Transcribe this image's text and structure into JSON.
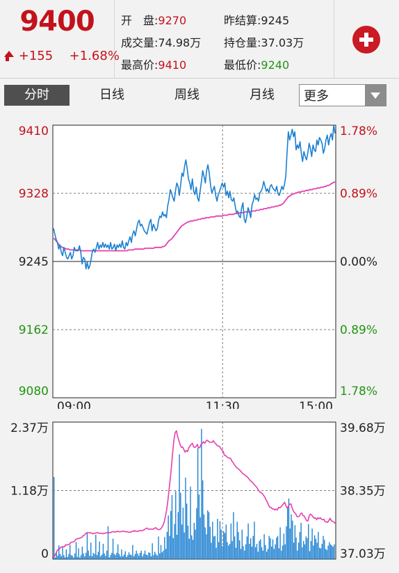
{
  "header": {
    "price": "9400",
    "change": "+155",
    "change_pct": "+1.68%",
    "stats": {
      "open_label": "开　盘:",
      "open_value": "9270",
      "prev_settle_label": "昨结算:",
      "prev_settle_value": "9245",
      "volume_label": "成交量:",
      "volume_value": "74.98万",
      "open_interest_label": "持仓量:",
      "open_interest_value": "37.03万",
      "high_label": "最高价:",
      "high_value": "9410",
      "low_label": "最低价:",
      "low_value": "9240"
    },
    "add_icon": "plus-circle-icon"
  },
  "tabs": [
    {
      "label": "分时",
      "active": true
    },
    {
      "label": "日线",
      "active": false
    },
    {
      "label": "周线",
      "active": false
    },
    {
      "label": "月线",
      "active": false
    }
  ],
  "more_select": {
    "label": "更多",
    "icon": "chevron-down-icon"
  },
  "colors": {
    "up": "#c3121b",
    "down": "#229412",
    "price_line": "#1b7fd1",
    "avg_line": "#e43fb0",
    "volume_bar": "#1b7fd1"
  },
  "chart_data": [
    {
      "type": "line",
      "title": "",
      "x_ticks": [
        "09:00",
        "11:30",
        "15:00"
      ],
      "y_ticks_left": [
        "9410",
        "9328",
        "9245",
        "9162",
        "9080"
      ],
      "y_ticks_right": [
        "1.78%",
        "0.89%",
        "0.00%",
        "0.89%",
        "1.78%"
      ],
      "ylim": [
        9080,
        9410
      ],
      "prev_close": 9245,
      "series": [
        {
          "values": [
            9285,
            9278,
            9272,
            9268,
            9260,
            9265,
            9256,
            9252,
            9262,
            9256,
            9250,
            9248,
            9252,
            9256,
            9248,
            9252,
            9262,
            9258,
            9258,
            9258,
            9264,
            9256,
            9242,
            9250,
            9248,
            9236,
            9244,
            9236,
            9240,
            9248,
            9258,
            9260,
            9256,
            9262,
            9268,
            9260,
            9265,
            9262,
            9268,
            9262,
            9266,
            9262,
            9265,
            9260,
            9268,
            9260,
            9262,
            9266,
            9258,
            9265,
            9262,
            9266,
            9262,
            9270,
            9262,
            9260,
            9268,
            9264,
            9270,
            9275,
            9268,
            9278,
            9282,
            9276,
            9284,
            9292,
            9295,
            9288,
            9290,
            9286,
            9282,
            9280,
            9278,
            9285,
            9292,
            9296,
            9282,
            9290,
            9286,
            9282,
            9285,
            9295,
            9300,
            9298,
            9305,
            9300,
            9302,
            9298,
            9312,
            9320,
            9332,
            9328,
            9322,
            9318,
            9330,
            9340,
            9336,
            9325,
            9338,
            9352,
            9348,
            9360,
            9368,
            9358,
            9345,
            9340,
            9332,
            9345,
            9330,
            9326,
            9335,
            9322,
            9318,
            9330,
            9342,
            9355,
            9348,
            9340,
            9355,
            9362,
            9352,
            9338,
            9328,
            9332,
            9336,
            9325,
            9318,
            9326,
            9330,
            9335,
            9340,
            9335,
            9340,
            9325,
            9330,
            9322,
            9330,
            9320,
            9318,
            9322,
            9312,
            9304,
            9306,
            9300,
            9298,
            9310,
            9316,
            9296,
            9292,
            9300,
            9310,
            9305,
            9298,
            9314,
            9318,
            9326,
            9320,
            9322,
            9318,
            9328,
            9330,
            9334,
            9342,
            9336,
            9330,
            9333,
            9328,
            9336,
            9338,
            9334,
            9332,
            9330,
            9336,
            9327,
            9325,
            9330,
            9336,
            9332,
            9338,
            9348,
            9376,
            9402,
            9392,
            9398,
            9405,
            9396,
            9402,
            9380,
            9386,
            9382,
            9390,
            9376,
            9366,
            9378,
            9372,
            9368,
            9376,
            9388,
            9382,
            9372,
            9386,
            9380,
            9378,
            9392,
            9386,
            9395,
            9392,
            9388,
            9376,
            9382,
            9392,
            9398,
            9386,
            9395,
            9400,
            9392,
            9410,
            9400
          ]
        },
        {
          "values": [
            9273,
            9272,
            9270,
            9268,
            9266,
            9264,
            9263,
            9262,
            9261,
            9261,
            9260,
            9260,
            9260,
            9259,
            9259,
            9259,
            9259,
            9259,
            9259,
            9259,
            9259,
            9259,
            9258,
            9258,
            9258,
            9258,
            9258,
            9258,
            9258,
            9258,
            9258,
            9258,
            9258,
            9258,
            9258,
            9258,
            9258,
            9258,
            9258,
            9258,
            9258,
            9258,
            9258,
            9258,
            9258,
            9258,
            9258,
            9258,
            9258,
            9258,
            9258,
            9258,
            9258,
            9258,
            9258,
            9258,
            9258,
            9258,
            9258,
            9259,
            9259,
            9259,
            9259,
            9259,
            9260,
            9260,
            9260,
            9260,
            9260,
            9260,
            9260,
            9260,
            9261,
            9261,
            9261,
            9261,
            9261,
            9261,
            9261,
            9261,
            9262,
            9262,
            9262,
            9262,
            9262,
            9262,
            9263,
            9263,
            9264,
            9266,
            9268,
            9270,
            9271,
            9272,
            9274,
            9276,
            9278,
            9280,
            9282,
            9284,
            9286,
            9288,
            9289,
            9290,
            9291,
            9292,
            9293,
            9293,
            9294,
            9294,
            9294,
            9295,
            9295,
            9295,
            9296,
            9296,
            9296,
            9297,
            9297,
            9297,
            9298,
            9298,
            9298,
            9298,
            9299,
            9299,
            9299,
            9299,
            9300,
            9300,
            9300,
            9300,
            9300,
            9300,
            9301,
            9301,
            9301,
            9301,
            9302,
            9302,
            9302,
            9302,
            9302,
            9303,
            9303,
            9303,
            9303,
            9304,
            9304,
            9304,
            9304,
            9305,
            9305,
            9305,
            9305,
            9305,
            9306,
            9306,
            9306,
            9306,
            9307,
            9307,
            9307,
            9308,
            9308,
            9308,
            9309,
            9309,
            9309,
            9310,
            9310,
            9310,
            9311,
            9311,
            9311,
            9312,
            9312,
            9312,
            9313,
            9313,
            9314,
            9315,
            9317,
            9319,
            9321,
            9323,
            9324,
            9325,
            9326,
            9327,
            9327,
            9328,
            9328,
            9329,
            9329,
            9329,
            9330,
            9330,
            9330,
            9331,
            9331,
            9331,
            9332,
            9332,
            9332,
            9333,
            9333,
            9333,
            9334,
            9334,
            9334,
            9335,
            9335,
            9335,
            9336,
            9336,
            9337,
            9337,
            9338,
            9339,
            9340,
            9341,
            9341
          ]
        }
      ]
    },
    {
      "type": "bar",
      "title": "",
      "y_ticks_left": [
        "2.37万",
        "1.18万",
        "0"
      ],
      "y_ticks_right": [
        "39.68万",
        "38.35万",
        "37.03万"
      ],
      "volume_max": 23700,
      "oi_range": [
        370300,
        396800
      ],
      "volume": [
        14500,
        300,
        1200,
        600,
        2400,
        900,
        500,
        2200,
        700,
        300,
        1700,
        400,
        900,
        2500,
        700,
        600,
        300,
        1000,
        3000,
        400,
        1900,
        300,
        700,
        2200,
        1000,
        500,
        1100,
        4600,
        1500,
        600,
        2900,
        500,
        1100,
        900,
        4300,
        700,
        1300,
        3100,
        500,
        800,
        2700,
        1000,
        600,
        1500,
        5800,
        300,
        700,
        1100,
        3600,
        900,
        700,
        1100,
        2600,
        900,
        500,
        1700,
        500,
        800,
        1400,
        400,
        700,
        1200,
        800,
        700,
        2500,
        500,
        900,
        1500,
        1000,
        600,
        1100,
        1500,
        500,
        900,
        1500,
        800,
        700,
        1200,
        1100,
        500,
        2800,
        700,
        1300,
        900,
        600,
        4000,
        1000,
        2500,
        1200,
        1500,
        3900,
        1800,
        4800,
        7700,
        4100,
        8500,
        11300,
        3700,
        6200,
        12000,
        4300,
        8300,
        18500,
        11700,
        6100,
        9100,
        4700,
        14400,
        9800,
        5900,
        3600,
        12800,
        4200,
        3400,
        6400,
        5200,
        9000,
        19600,
        11400,
        7400,
        23000,
        13900,
        7900,
        5600,
        4400,
        8600,
        8300,
        5700,
        2900,
        6600,
        4000,
        4100,
        2000,
        7100,
        3000,
        6700,
        5200,
        2300,
        4900,
        4600,
        6100,
        3000,
        2400,
        2700,
        6300,
        3200,
        8300,
        4000,
        2000,
        6600,
        4800,
        3300,
        1800,
        5200,
        2300,
        1500,
        2600,
        4000,
        6300,
        2700,
        3700,
        2200,
        4100,
        6600,
        2100,
        2700,
        1300,
        3200,
        3500,
        2100,
        1500,
        4400,
        2500,
        1300,
        1800,
        4100,
        3700,
        2200,
        3500,
        1800,
        2600,
        3800,
        4100,
        1900,
        5600,
        1500,
        2400,
        4500,
        2600,
        5800,
        9100,
        10700,
        5400,
        7900,
        6800,
        2900,
        6000,
        3800,
        1500,
        2900,
        4800,
        6400,
        2100,
        3200,
        2600,
        4000,
        3700,
        6200,
        1400,
        3200,
        5400,
        2400,
        4200,
        3600,
        2900,
        4800,
        2000,
        1900,
        2700,
        4100,
        3400,
        1800,
        1600,
        2400,
        3000,
        2600,
        2400,
        2200,
        2600
      ],
      "open_interest": [
        370600,
        371000,
        371400,
        372000,
        372200,
        372300,
        372600,
        372700,
        372700,
        372700,
        373100,
        373000,
        373100,
        373200,
        373500,
        373600,
        373600,
        373700,
        374100,
        374200,
        374300,
        374300,
        374400,
        374500,
        374800,
        374900,
        375200,
        375400,
        375400,
        375400,
        375400,
        375300,
        375200,
        375300,
        375300,
        375400,
        375400,
        375300,
        375300,
        375300,
        375200,
        375300,
        375300,
        375400,
        375400,
        375400,
        375400,
        375500,
        375600,
        375600,
        375500,
        375600,
        375700,
        375600,
        375600,
        375600,
        375700,
        375700,
        375600,
        375600,
        375600,
        375500,
        375500,
        375500,
        375700,
        375700,
        375800,
        375700,
        375700,
        375700,
        375800,
        375800,
        375800,
        375900,
        376000,
        376200,
        376300,
        376100,
        376100,
        376100,
        376100,
        376100,
        376200,
        376400,
        376200,
        376000,
        376000,
        376100,
        376400,
        376800,
        377500,
        378500,
        379800,
        381600,
        383700,
        385900,
        388400,
        391200,
        393500,
        394800,
        395100,
        394000,
        393200,
        392400,
        391900,
        392000,
        391500,
        391000,
        391300,
        391100,
        391800,
        392200,
        392500,
        392700,
        392000,
        391900,
        392100,
        392500,
        391800,
        391900,
        392500,
        392700,
        393000,
        392700,
        393100,
        393300,
        393100,
        392900,
        392900,
        392900,
        393200,
        392800,
        392600,
        392300,
        392200,
        392100,
        391700,
        391400,
        391100,
        390400,
        390300,
        390100,
        389900,
        389800,
        389800,
        389300,
        389000,
        388600,
        388300,
        388000,
        387800,
        387600,
        387400,
        387100,
        386800,
        386700,
        386500,
        386300,
        386100,
        385800,
        385500,
        385300,
        385100,
        384800,
        384500,
        384300,
        383900,
        383500,
        383300,
        383100,
        382900,
        382600,
        382200,
        381700,
        381300,
        380700,
        380300,
        380300,
        380000,
        380000,
        379800,
        380000,
        379800,
        380300,
        380200,
        380400,
        380700,
        381000,
        381300,
        380600,
        380200,
        380500,
        380900,
        381000,
        380300,
        379600,
        379300,
        379100,
        378500,
        378500,
        378600,
        379100,
        379200,
        378700,
        378600,
        378100,
        377700,
        377700,
        378700,
        379000,
        378800,
        378500,
        378200,
        378300,
        377900,
        378300,
        378100,
        378300,
        378000,
        377900,
        378000,
        377500,
        377500,
        377400,
        377800,
        378200,
        377700,
        377600,
        377500,
        377200
      ]
    }
  ]
}
